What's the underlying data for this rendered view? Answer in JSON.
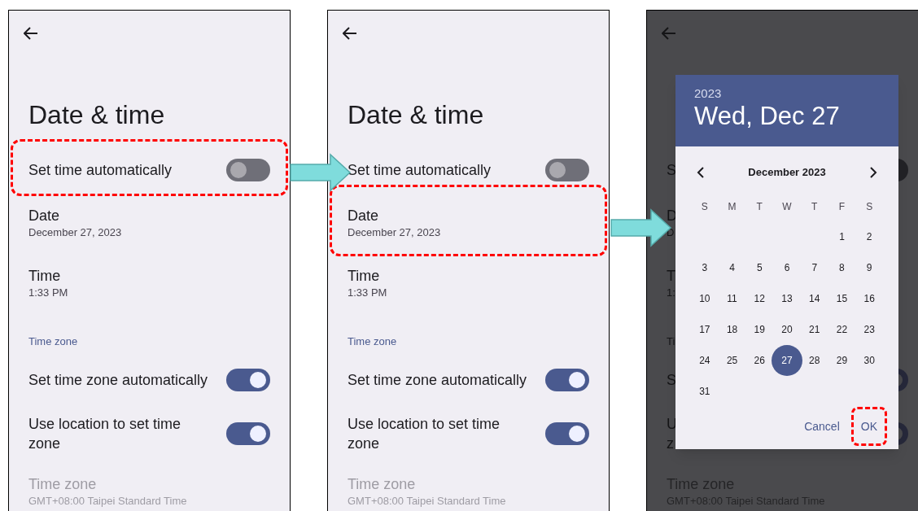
{
  "panels": [
    {
      "dimmed": false,
      "title": "Date & time",
      "items": [
        {
          "kind": "switch",
          "label": "Set time automatically",
          "on": false,
          "highlighted": true
        },
        {
          "kind": "detail",
          "label": "Date",
          "value": "December 27, 2023",
          "highlighted": false
        },
        {
          "kind": "detail",
          "label": "Time",
          "value": "1:33 PM",
          "highlighted": false
        },
        {
          "kind": "header",
          "label": "Time zone"
        },
        {
          "kind": "switch",
          "label": "Set time zone automatically",
          "on": true,
          "highlighted": false
        },
        {
          "kind": "switch",
          "label": "Use location to set time zone",
          "on": true,
          "highlighted": false
        },
        {
          "kind": "detail",
          "label": "Time zone",
          "value": "GMT+08:00 Taipei Standard Time",
          "disabled": true,
          "highlighted": false
        }
      ]
    },
    {
      "dimmed": false,
      "title": "Date & time",
      "items": [
        {
          "kind": "switch",
          "label": "Set time automatically",
          "on": false,
          "highlighted": false
        },
        {
          "kind": "detail",
          "label": "Date",
          "value": "December 27, 2023",
          "highlighted": true
        },
        {
          "kind": "detail",
          "label": "Time",
          "value": "1:33 PM",
          "highlighted": false
        },
        {
          "kind": "header",
          "label": "Time zone"
        },
        {
          "kind": "switch",
          "label": "Set time zone automatically",
          "on": true,
          "highlighted": false
        },
        {
          "kind": "switch",
          "label": "Use location to set time zone",
          "on": true,
          "highlighted": false
        },
        {
          "kind": "detail",
          "label": "Time zone",
          "value": "GMT+08:00 Taipei Standard Time",
          "disabled": true,
          "highlighted": false
        }
      ]
    },
    {
      "dimmed": true,
      "items": [
        {
          "kind": "switch",
          "label": "S",
          "on": false,
          "highlighted": false
        },
        {
          "kind": "detail",
          "label": "D",
          "value": "D",
          "highlighted": false
        },
        {
          "kind": "detail",
          "label": "T",
          "value": "1:",
          "highlighted": false
        },
        {
          "kind": "header",
          "label": "Ti"
        },
        {
          "kind": "switch",
          "label": "S",
          "on": true,
          "highlighted": false
        },
        {
          "kind": "switch",
          "label": "U\nz",
          "on": true,
          "highlighted": false
        },
        {
          "kind": "detail",
          "label": "Time zone",
          "value": "GMT+08:00 Taipei Standard Time",
          "disabled": true,
          "highlighted": false
        }
      ],
      "dialog": {
        "year": "2023",
        "date": "Wed, Dec 27",
        "month": "December 2023",
        "weekdays": [
          "S",
          "M",
          "T",
          "W",
          "T",
          "F",
          "S"
        ],
        "weeks": [
          {
            "kind": "first",
            "days": [
              {
                "label": "1",
                "selected": false
              },
              {
                "label": "2",
                "selected": false
              }
            ]
          },
          {
            "kind": "full",
            "days": [
              {
                "label": "3",
                "selected": false
              },
              {
                "label": "4",
                "selected": false
              },
              {
                "label": "5",
                "selected": false
              },
              {
                "label": "6",
                "selected": false
              },
              {
                "label": "7",
                "selected": false
              },
              {
                "label": "8",
                "selected": false
              },
              {
                "label": "9",
                "selected": false
              }
            ]
          },
          {
            "kind": "full",
            "days": [
              {
                "label": "10",
                "selected": false
              },
              {
                "label": "11",
                "selected": false
              },
              {
                "label": "12",
                "selected": false
              },
              {
                "label": "13",
                "selected": false
              },
              {
                "label": "14",
                "selected": false
              },
              {
                "label": "15",
                "selected": false
              },
              {
                "label": "16",
                "selected": false
              }
            ]
          },
          {
            "kind": "full",
            "days": [
              {
                "label": "17",
                "selected": false
              },
              {
                "label": "18",
                "selected": false
              },
              {
                "label": "19",
                "selected": false
              },
              {
                "label": "20",
                "selected": false
              },
              {
                "label": "21",
                "selected": false
              },
              {
                "label": "22",
                "selected": false
              },
              {
                "label": "23",
                "selected": false
              }
            ]
          },
          {
            "kind": "full",
            "days": [
              {
                "label": "24",
                "selected": false
              },
              {
                "label": "25",
                "selected": false
              },
              {
                "label": "26",
                "selected": false
              },
              {
                "label": "27",
                "selected": true
              },
              {
                "label": "28",
                "selected": false
              },
              {
                "label": "29",
                "selected": false
              },
              {
                "label": "30",
                "selected": false
              }
            ]
          },
          {
            "kind": "last",
            "days": [
              {
                "label": "31",
                "selected": false
              }
            ]
          }
        ],
        "buttons": [
          {
            "label": "Cancel",
            "highlighted": false
          },
          {
            "label": "OK",
            "highlighted": true
          }
        ]
      }
    }
  ]
}
